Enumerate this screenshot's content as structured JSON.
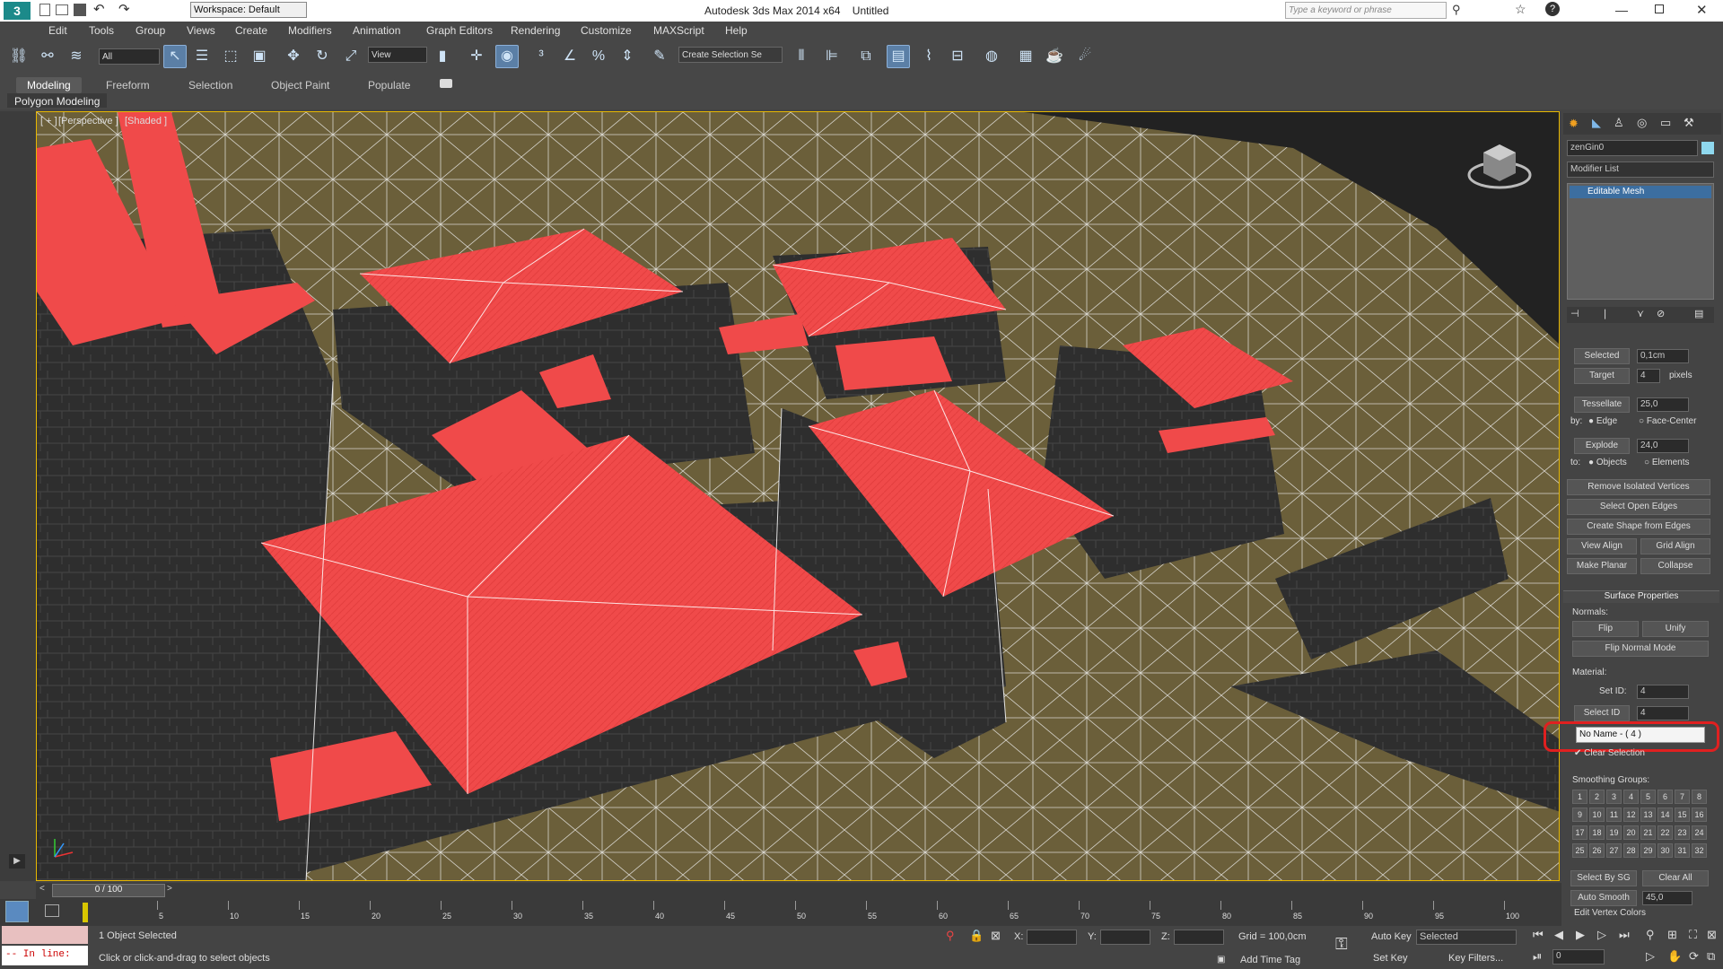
{
  "title": {
    "app": "Autodesk 3ds Max  2014 x64",
    "doc": "Untitled",
    "workspace": "Workspace: Default",
    "search_placeholder": "Type a keyword or phrase"
  },
  "menu": [
    "Edit",
    "Tools",
    "Group",
    "Views",
    "Create",
    "Modifiers",
    "Animation",
    "Graph Editors",
    "Rendering",
    "Customize",
    "MAXScript",
    "Help"
  ],
  "toolbar": {
    "filter": "All",
    "refcoord": "View",
    "selset": "Create Selection Se"
  },
  "ribbon": {
    "tabs": [
      "Modeling",
      "Freeform",
      "Selection",
      "Object Paint",
      "Populate"
    ],
    "active": "Modeling",
    "panel": "Polygon Modeling"
  },
  "viewport": {
    "label_plus": "[ + ]",
    "label_view": "[Perspective ]",
    "label_shade": "[Shaded ]"
  },
  "cmd": {
    "object_name": "zenGin0",
    "modifier_list": "Modifier List",
    "stack_item": "Editable Mesh",
    "selected_btn": "Selected",
    "selected_val": "0,1cm",
    "target_btn": "Target",
    "target_val": "4",
    "pixels": "pixels",
    "tessellate_btn": "Tessellate",
    "tessellate_val": "25,0",
    "by": "by:",
    "edge": "Edge",
    "face_center": "Face-Center",
    "explode_btn": "Explode",
    "explode_val": "24,0",
    "to": "to:",
    "objects": "Objects",
    "elements": "Elements",
    "remove_iso": "Remove Isolated Vertices",
    "select_open": "Select Open Edges",
    "create_shape": "Create Shape from Edges",
    "view_align": "View Align",
    "grid_align": "Grid Align",
    "make_planar": "Make Planar",
    "collapse": "Collapse",
    "surface_props": "Surface Properties",
    "normals": "Normals:",
    "flip": "Flip",
    "unify": "Unify",
    "flip_normal_mode": "Flip Normal Mode",
    "material": "Material:",
    "set_id": "Set ID:",
    "set_id_val": "4",
    "select_id": "Select ID",
    "select_id_val": "4",
    "material_dropdown": "No Name - ( 4 )",
    "clear_selection": "Clear Selection",
    "smoothing_groups": "Smoothing Groups:",
    "sg": [
      "1",
      "2",
      "3",
      "4",
      "5",
      "6",
      "7",
      "8",
      "9",
      "10",
      "11",
      "12",
      "13",
      "14",
      "15",
      "16",
      "17",
      "18",
      "19",
      "20",
      "21",
      "22",
      "23",
      "24",
      "25",
      "26",
      "27",
      "28",
      "29",
      "30",
      "31",
      "32"
    ],
    "select_by_sg": "Select By SG",
    "clear_all": "Clear All",
    "auto_smooth": "Auto Smooth",
    "auto_smooth_val": "45,0",
    "edit_vertex_colors": "Edit Vertex Colors"
  },
  "timeline": {
    "frame": "0 / 100",
    "ticks": [
      "5",
      "10",
      "15",
      "20",
      "25",
      "30",
      "35",
      "40",
      "45",
      "50",
      "55",
      "60",
      "65",
      "70",
      "75",
      "80",
      "85",
      "90",
      "95",
      "100"
    ]
  },
  "status": {
    "objects_selected": "1 Object Selected",
    "prompt": "Click or click-and-drag to select objects",
    "maxscript": "-- In line:",
    "x": "X:",
    "y": "Y:",
    "z": "Z:",
    "grid": "Grid = 100,0cm",
    "add_time_tag": "Add Time Tag",
    "auto_key": "Auto Key",
    "set_key": "Set Key",
    "key_mode": "Selected",
    "key_filters": "Key Filters...",
    "frame_val": "0"
  },
  "colors": {
    "roof": "#f04a4a",
    "terrain": "#6b5f3a",
    "highlight": "#e02020"
  }
}
